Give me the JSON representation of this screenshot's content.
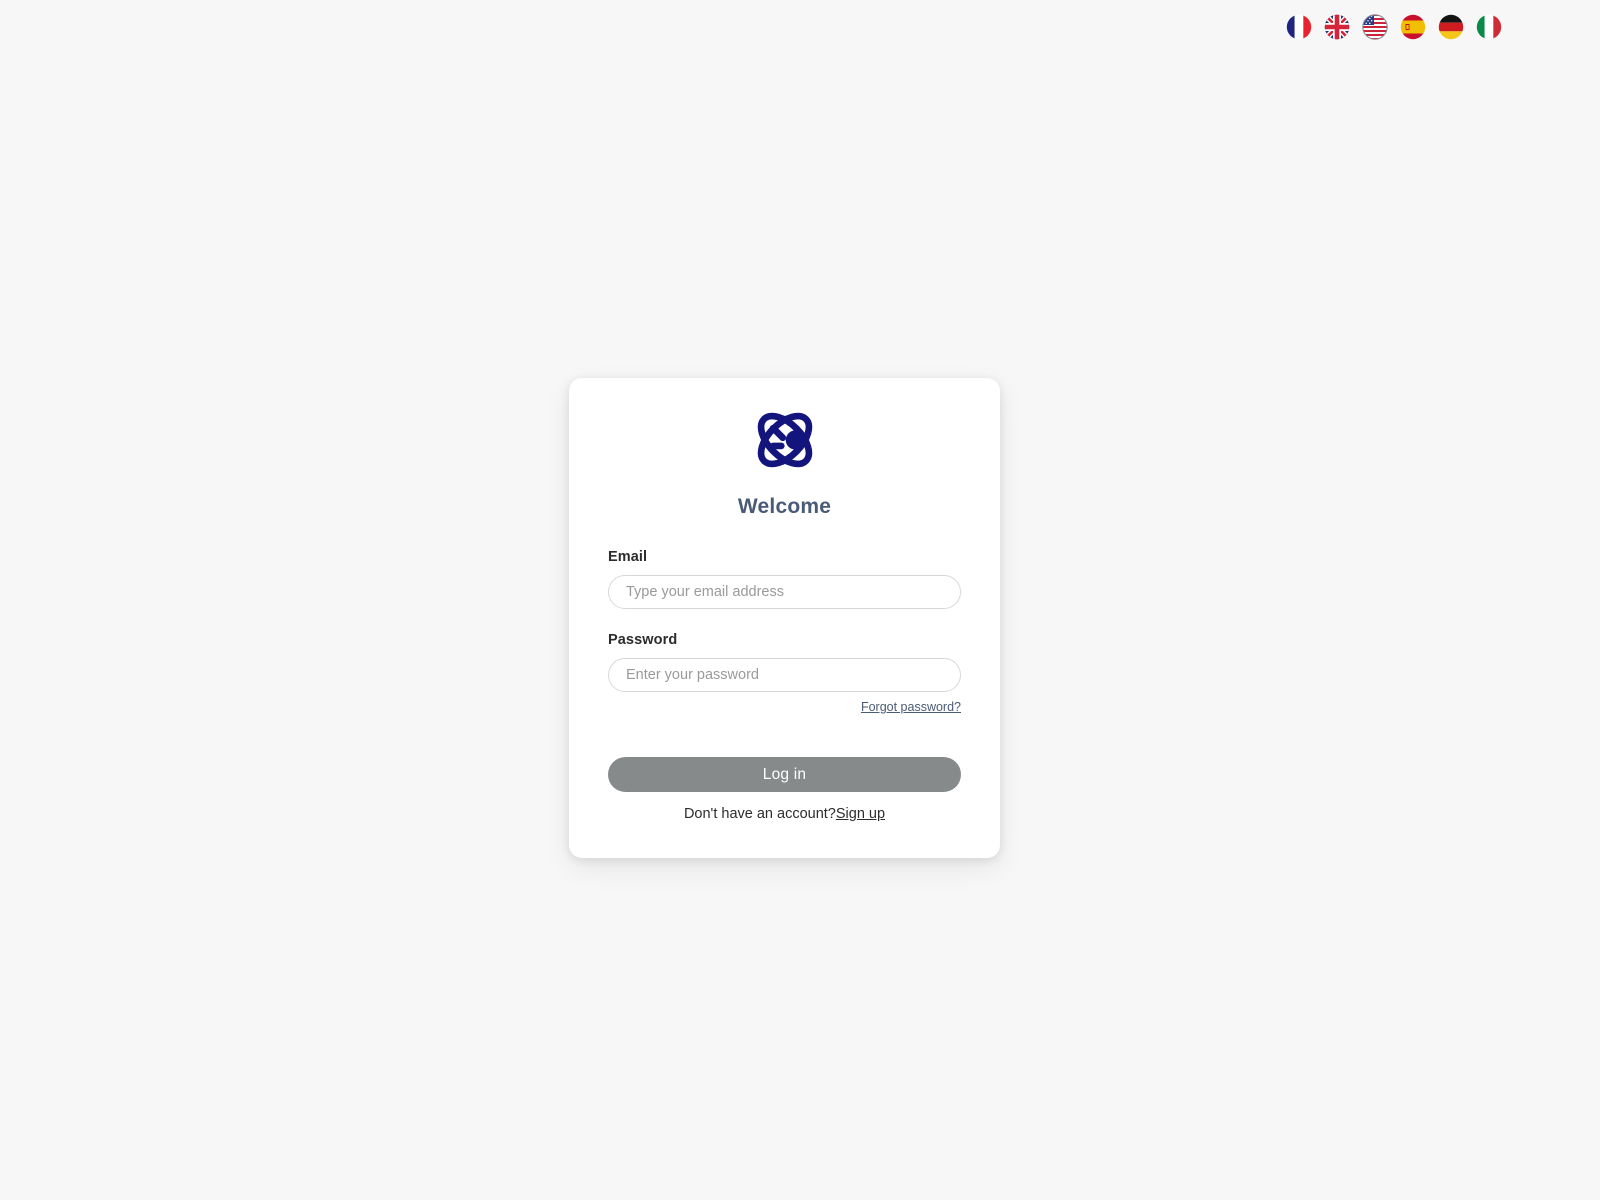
{
  "page": {
    "background_color": "#f7f7f7"
  },
  "language_bar": {
    "flags": [
      {
        "name": "flag-france",
        "label": "French",
        "code": "fr"
      },
      {
        "name": "flag-uk",
        "label": "English (UK)",
        "code": "gb"
      },
      {
        "name": "flag-usa",
        "label": "English (US)",
        "code": "us"
      },
      {
        "name": "flag-spain",
        "label": "Spanish",
        "code": "es"
      },
      {
        "name": "flag-germany",
        "label": "German",
        "code": "de"
      },
      {
        "name": "flag-italy",
        "label": "Italian",
        "code": "it"
      }
    ]
  },
  "card": {
    "logo_icon": "atom-orbit-logo",
    "logo_color": "#14147d",
    "title": "Welcome",
    "title_color": "#4a5b76",
    "form": {
      "email": {
        "label": "Email",
        "placeholder": "Type your email address",
        "value": ""
      },
      "password": {
        "label": "Password",
        "placeholder": "Enter your password",
        "value": ""
      },
      "forgot_password_label": "Forgot password?",
      "submit_label": "Log in",
      "submit_color": "#878a8b"
    },
    "signup": {
      "prompt": "Don't have an account?",
      "link_label": "Sign up"
    }
  }
}
